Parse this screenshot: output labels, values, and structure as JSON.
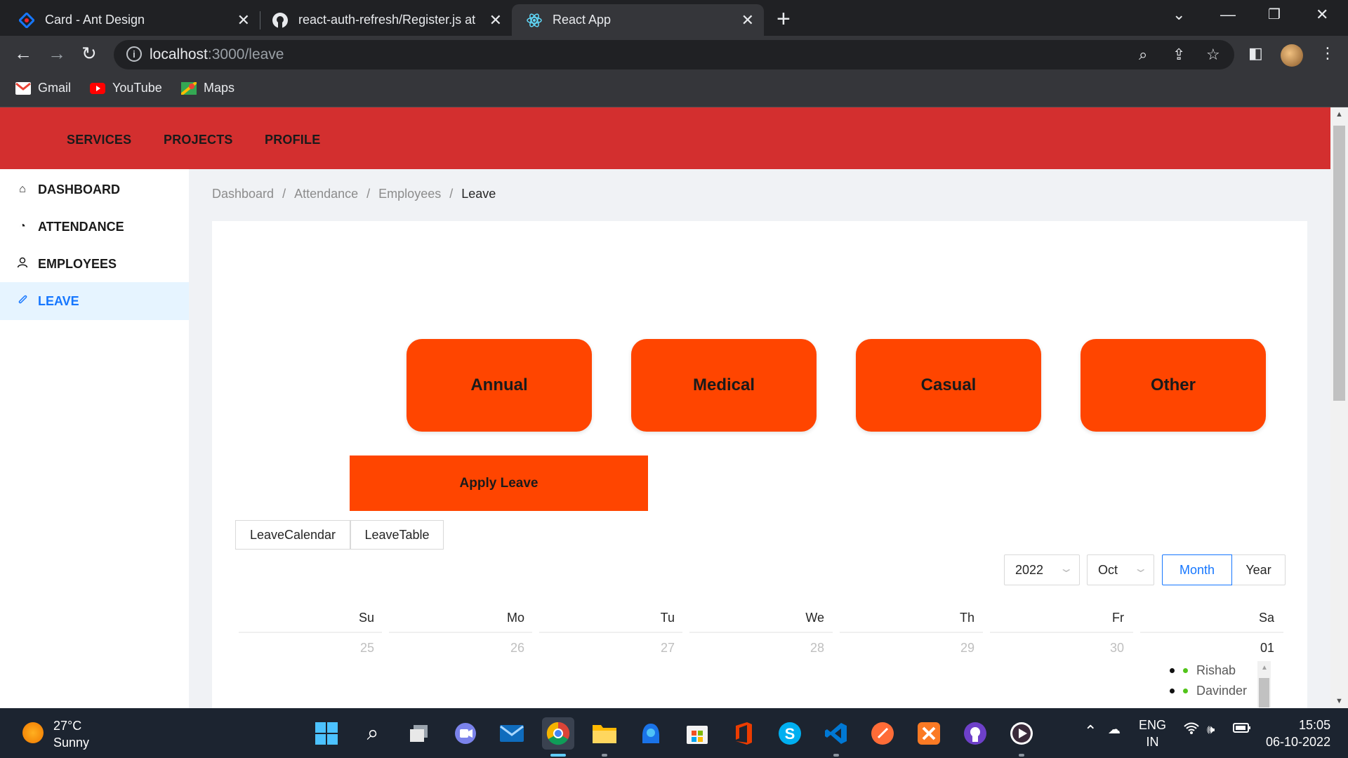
{
  "browser": {
    "tabs": [
      {
        "title": "Card - Ant Design",
        "active": false
      },
      {
        "title": "react-auth-refresh/Register.js at m",
        "active": false
      },
      {
        "title": "React App",
        "active": true
      }
    ],
    "new_tab": "+",
    "url_host": "localhost",
    "url_path": ":3000/leave",
    "bookmarks": [
      "Gmail",
      "YouTube",
      "Maps"
    ]
  },
  "header": {
    "nav": [
      "SERVICES",
      "PROJECTS",
      "PROFILE"
    ],
    "color": "#d32f2f"
  },
  "sidebar": {
    "items": [
      {
        "label": "DASHBOARD",
        "icon": "home-icon",
        "selected": false
      },
      {
        "label": "ATTENDANCE",
        "icon": "dashboard-icon",
        "selected": false
      },
      {
        "label": "EMPLOYEES",
        "icon": "user-icon",
        "selected": false
      },
      {
        "label": "LEAVE",
        "icon": "paperclip-icon",
        "selected": true
      }
    ]
  },
  "breadcrumb": [
    "Dashboard",
    "Attendance",
    "Employees",
    "Leave"
  ],
  "leave_types": [
    "Annual",
    "Medical",
    "Casual",
    "Other"
  ],
  "accent_color": "#ff4500",
  "apply_button": "Apply Leave",
  "view_tabs": [
    "LeaveCalendar",
    "LeaveTable"
  ],
  "calendar": {
    "year": "2022",
    "month": "Oct",
    "modes": [
      "Month",
      "Year"
    ],
    "active_mode": "Month",
    "weekdays": [
      "Su",
      "Mo",
      "Tu",
      "We",
      "Th",
      "Fr",
      "Sa"
    ],
    "first_row_dates": [
      "25",
      "26",
      "27",
      "28",
      "29",
      "30",
      "01"
    ],
    "events": [
      "Rishab",
      "Davinder"
    ]
  },
  "taskbar": {
    "temperature": "27°C",
    "weather": "Sunny",
    "lang_top": "ENG",
    "lang_bottom": "IN",
    "time": "15:05",
    "date": "06-10-2022"
  }
}
